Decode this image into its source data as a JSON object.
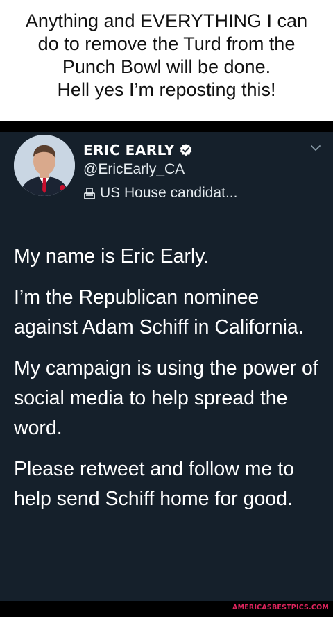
{
  "caption": {
    "lines": [
      "Anything and EVERYTHING I can",
      "do to remove the Turd from the",
      "Punch Bowl will be done.",
      "Hell yes I’m reposting this!"
    ]
  },
  "tweet": {
    "display_name": "ERIC EARLY",
    "handle": "@EricEarly_CA",
    "bio": "US House candidat...",
    "icons": {
      "verified": "verified-badge-icon",
      "bio": "ballot-box-icon",
      "menu": "chevron-down-icon"
    },
    "paragraphs": [
      "My name is Eric Early.",
      "I’m the Republican nominee against Adam Schiff in California.",
      "My campaign is using the power of social media to help spread the word.",
      "Please retweet and follow me to help send Schiff home for good."
    ]
  },
  "watermark": "AMERICASBESTPICS.COM",
  "colors": {
    "tweet_background": "#15202b",
    "watermark": "#e0245e",
    "verified": "#ffffff"
  }
}
